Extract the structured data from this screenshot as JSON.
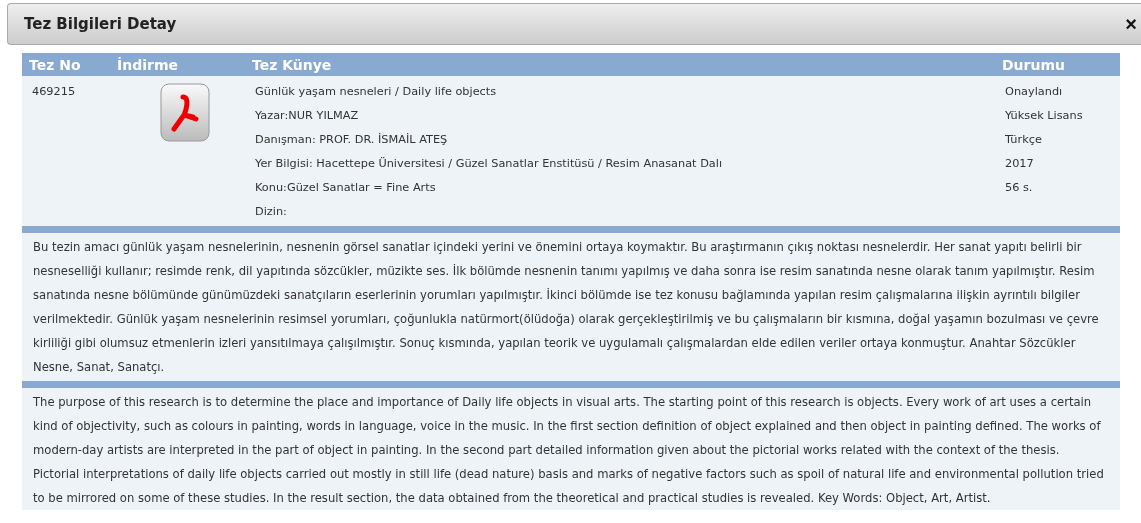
{
  "dialog": {
    "title": "Tez Bilgileri Detay",
    "close": "×"
  },
  "table": {
    "columns": [
      "Tez No",
      "İndirme",
      "Tez Künye",
      "Durumu"
    ],
    "tez_no": "469215",
    "kunye": [
      "Günlük yaşam nesneleri / Daily life objects",
      "Yazar:NUR YILMAZ",
      "Danışman: PROF. DR. İSMAİL ATEŞ",
      "Yer Bilgisi: Hacettepe Üniversitesi / Güzel Sanatlar Enstitüsü / Resim Anasanat Dalı",
      "Konu:Güzel Sanatlar = Fine Arts",
      "Dizin:"
    ],
    "durum": [
      "Onaylandı",
      "Yüksek Lisans",
      "Türkçe",
      "2017",
      "56 s."
    ]
  },
  "abstracts": [
    "Bu tezin amacı günlük yaşam nesnelerinin, nesnenin görsel sanatlar içindeki yerini ve önemini ortaya koymaktır. Bu araştırmanın çıkış noktası nesnelerdir. Her sanat yapıtı belirli bir nesneselliği kullanır; resimde renk, dil yapıtında sözcükler, müzikte ses. İlk bölümde nesnenin tanımı yapılmış ve daha sonra ise resim sanatında nesne olarak tanım yapılmıştır. Resim sanatında nesne bölümünde günümüzdeki sanatçıların eserlerinin yorumları yapılmıştır. İkinci bölümde ise tez konusu bağlamında yapılan resim çalışmalarına ilişkin ayrıntılı bilgiler verilmektedir. Günlük yaşam nesnelerinin resimsel yorumları, çoğunlukla natürmort(ölüdoğa) olarak gerçekleştirilmiş ve bu çalışmaların bir kısmına, doğal yaşamın bozulması ve çevre kirliliği gibi olumsuz etmenlerin izleri yansıtılmaya çalışılmıştır. Sonuç kısmında, yapılan teorik ve uygulamalı çalışmalardan elde edilen veriler ortaya konmuştur. Anahtar Sözcükler Nesne, Sanat, Sanatçı.",
    "The purpose of this research is to determine the place and importance of Daily life objects in visual arts. The starting point of this research is objects. Every work of art uses a certain kind of objectivity, such as colours in painting, words in language, voice in the music. In the first section definition of object explained and then object in painting defined. The works of modern-day artists are interpreted in the part of object in painting. In the second part detailed information given about the pictorial works related with the context of the thesis. Pictorial interpretations of daily life objects carried out mostly in still life (dead nature) basis and marks of negative factors such as spoil of natural life and environmental pollution tried to be mirrored on some of these studies. In the result section, the data obtained from the theoretical and practical studies is revealed. Key Words: Object, Art, Artist."
  ]
}
